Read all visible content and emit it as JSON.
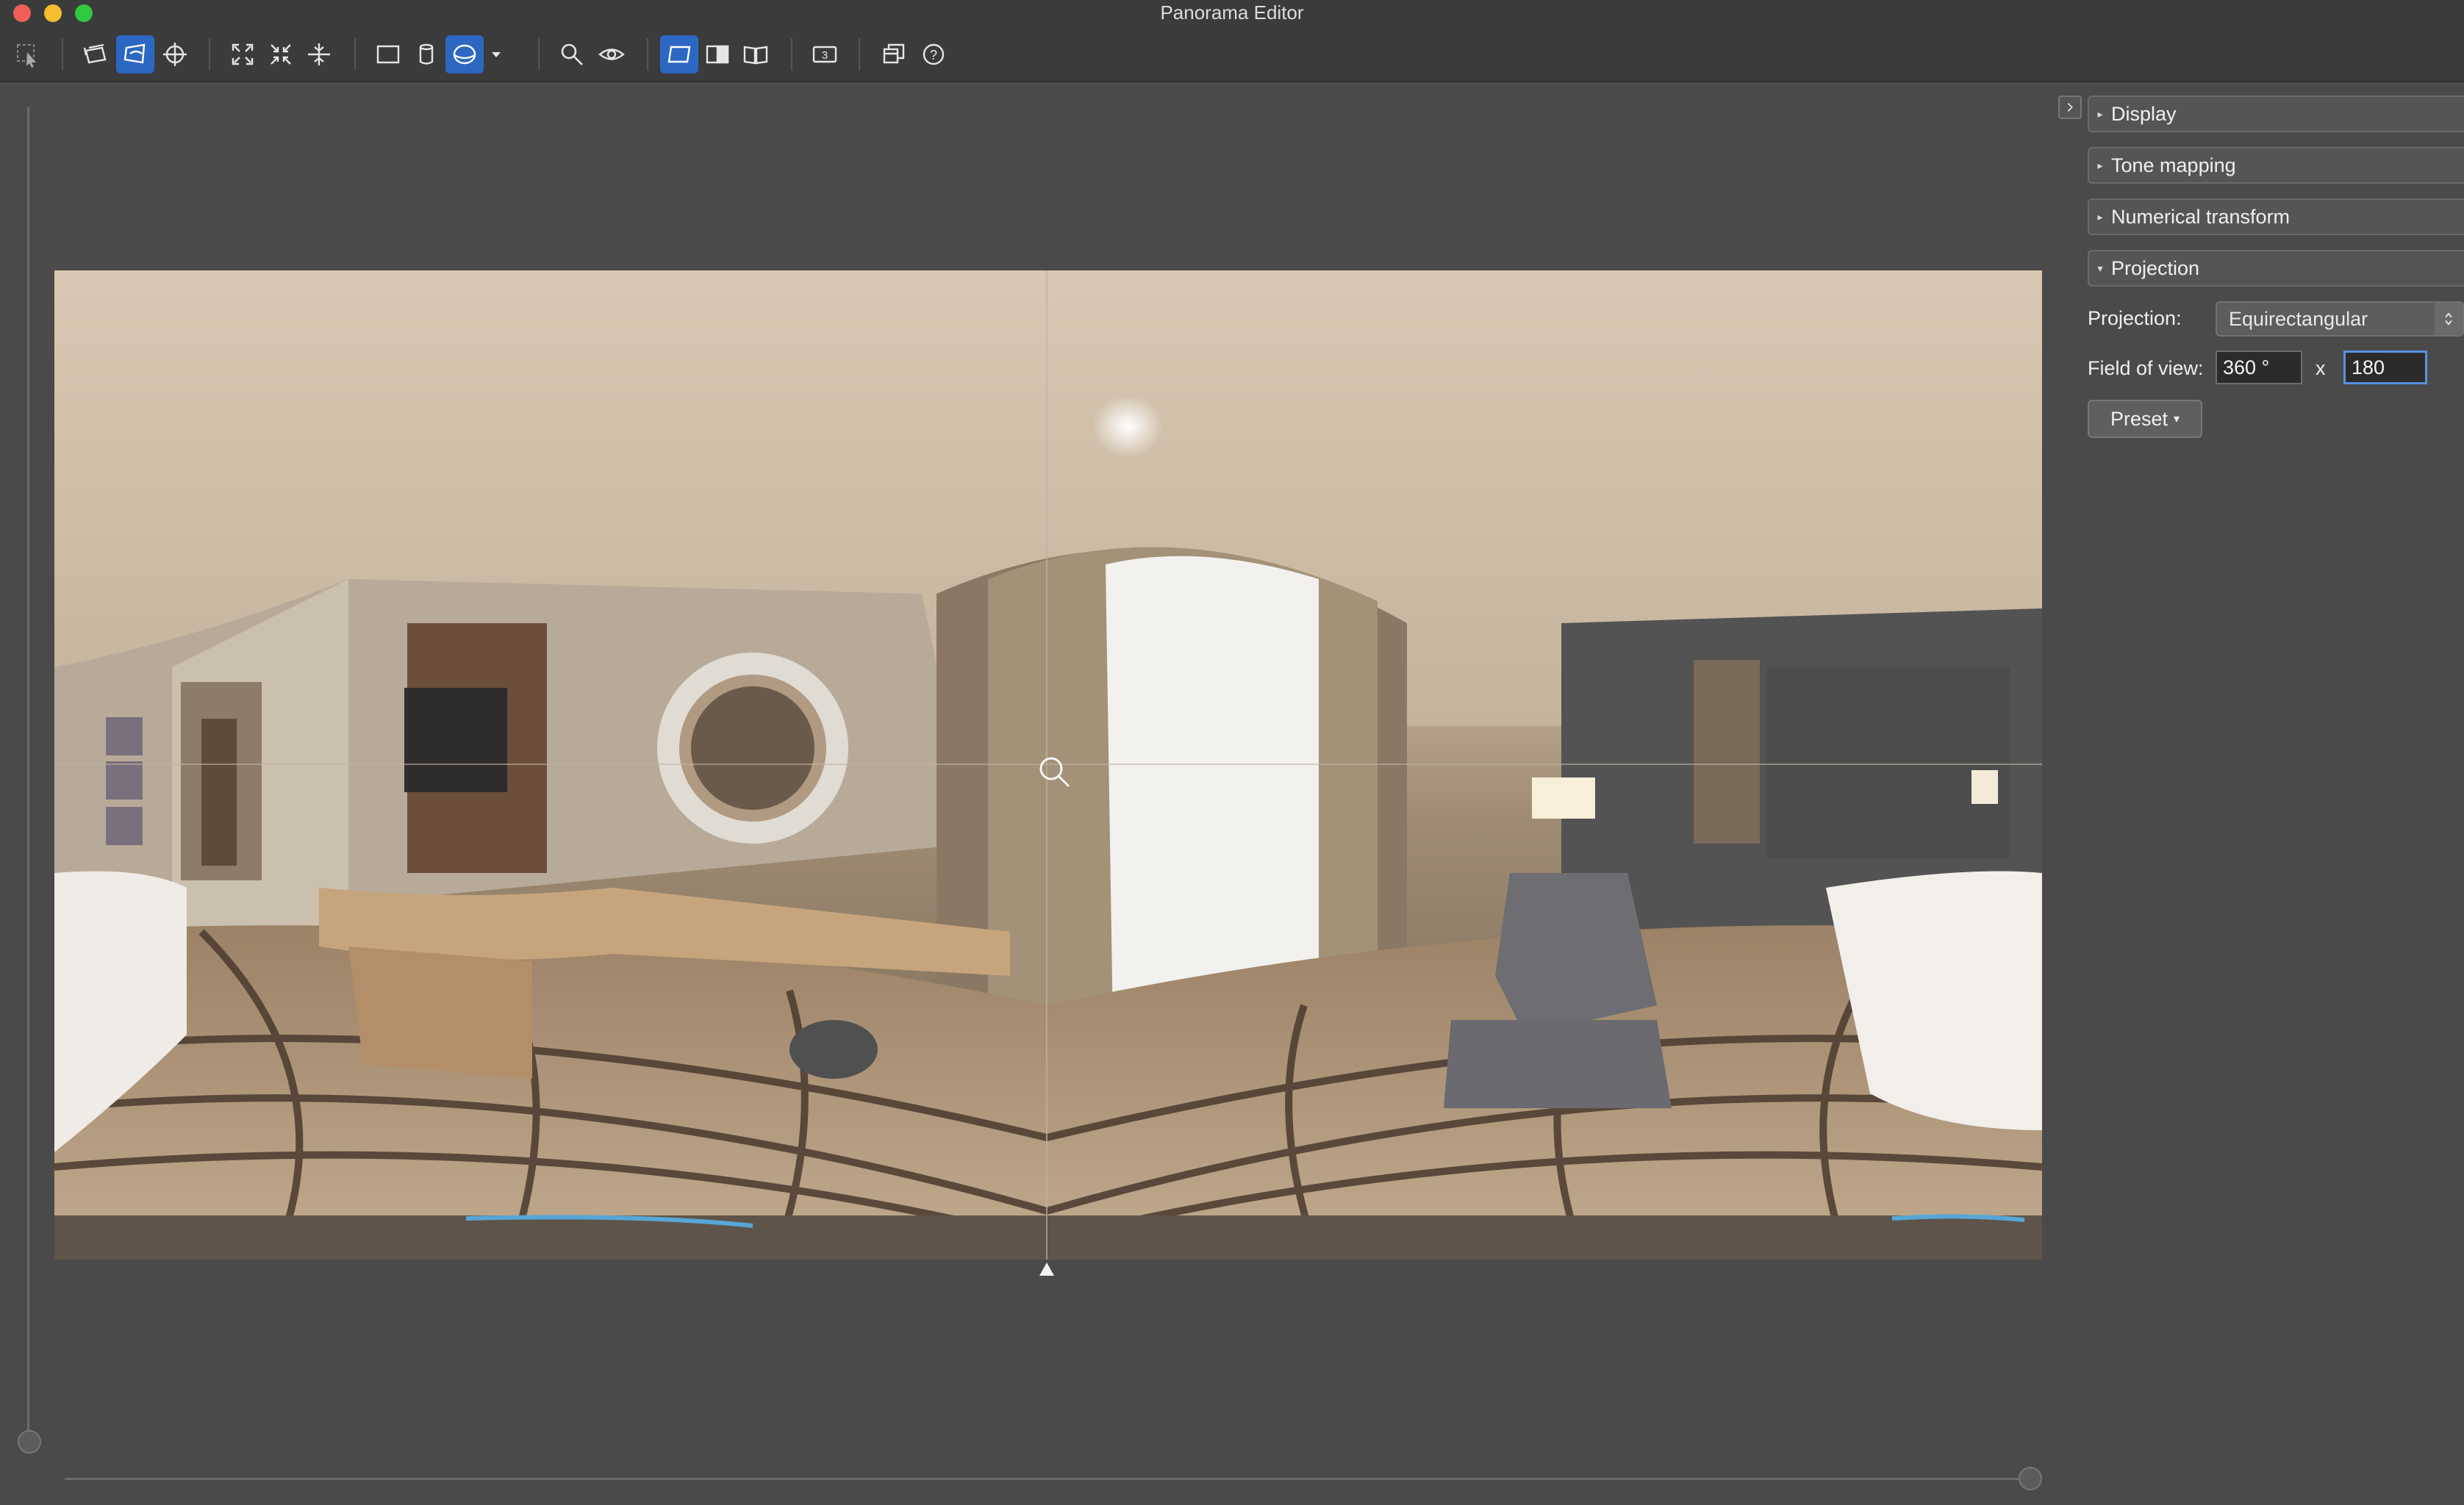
{
  "window": {
    "title": "Panorama Editor"
  },
  "panel": {
    "sections": [
      {
        "label": "Display",
        "expanded": false
      },
      {
        "label": "Tone mapping",
        "expanded": false
      },
      {
        "label": "Numerical transform",
        "expanded": false
      },
      {
        "label": "Projection",
        "expanded": true
      }
    ],
    "projection": {
      "label": "Projection:",
      "value": "Equirectangular"
    },
    "field_of_view": {
      "label": "Field of view:",
      "horizontal": "360 °",
      "separator": "x",
      "vertical": "180"
    },
    "preset_label": "Preset"
  },
  "colors": {
    "accent": "#2d67c4",
    "background": "#4a4a4a",
    "toolbar": "#3b3b3b"
  }
}
